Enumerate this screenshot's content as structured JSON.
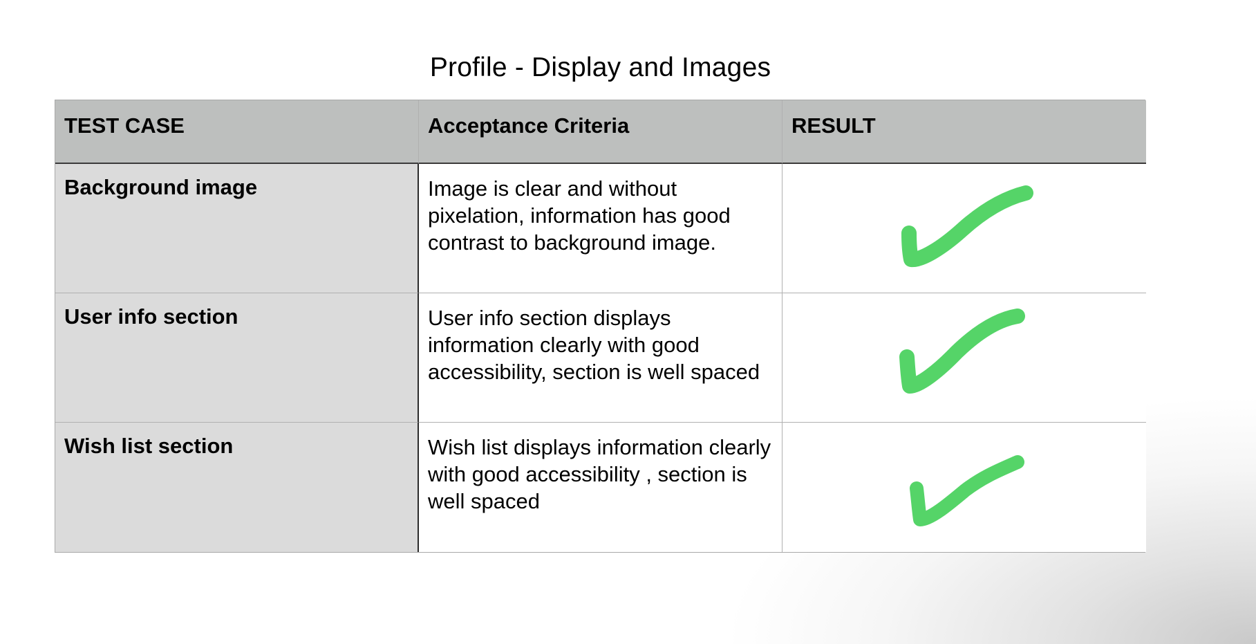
{
  "title": "Profile - Display and Images",
  "table": {
    "headers": [
      "TEST CASE",
      "Acceptance Criteria",
      "RESULT"
    ],
    "rows": [
      {
        "test_case": "Background image",
        "criteria": "Image is clear and without pixelation, information has good contrast to background image.",
        "result_icon": "checkmark-icon"
      },
      {
        "test_case": "User info section",
        "criteria": "User info section displays information clearly with good accessibility, section is well spaced",
        "result_icon": "checkmark-icon"
      },
      {
        "test_case": "Wish list section",
        "criteria": "Wish list displays information clearly with good accessibility , section is well spaced",
        "result_icon": "checkmark-icon"
      }
    ]
  },
  "colors": {
    "header_bg": "#bdbfbe",
    "case_col_bg": "#dbdbdb",
    "check_green": "#55d468"
  }
}
